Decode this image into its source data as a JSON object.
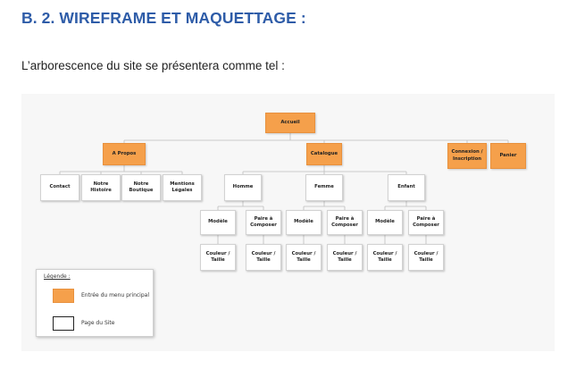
{
  "section_heading": "B. 2. WIREFRAME ET MAQUETTAGE :",
  "intro_text": "L’arborescence du site se présentera comme tel :",
  "sitemap": {
    "root": "Accueil",
    "menu": {
      "a_propos": "A Propos",
      "catalogue": "Catalogue",
      "connexion": "Connexion / Inscription",
      "panier": "Panier"
    },
    "a_propos_pages": [
      "Contact",
      "Notre Histoire",
      "Notre Boutique",
      "Mentions Légales"
    ],
    "categories": [
      "Homme",
      "Femme",
      "Enfant"
    ],
    "subpages": {
      "modele": "Modèle",
      "paire": "Paire à Composer",
      "couleur": "Couleur / Taille"
    }
  },
  "legend": {
    "title": "Légende :",
    "menu_entry": "Entrée du menu principal",
    "site_page": "Page du Site"
  },
  "colors": {
    "heading": "#2e5ca8",
    "menu_fill": "#f5a04b",
    "panel": "#f7f7f7"
  }
}
